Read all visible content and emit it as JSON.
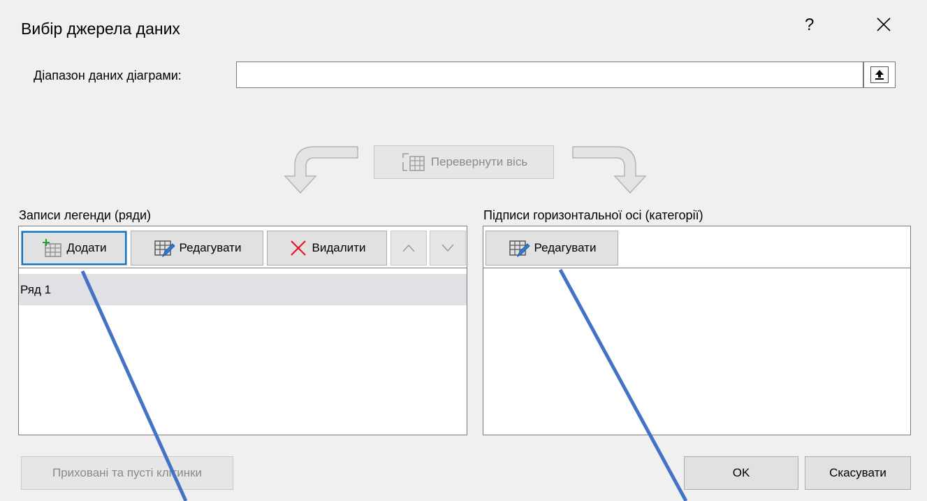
{
  "dialog": {
    "title": "Вибір джерела даних",
    "help": "?",
    "close_icon": "close-icon"
  },
  "range": {
    "label": "Діапазон даних діаграми:",
    "value": ""
  },
  "switch": {
    "label": "Перевернути вісь"
  },
  "legend": {
    "header": "Записи легенди (ряди)",
    "add_label": "Додати",
    "edit_label": "Редагувати",
    "delete_label": "Видалити",
    "series": [
      "Ряд 1"
    ]
  },
  "axis": {
    "header": "Підписи горизонтальної осі (категорії)",
    "edit_label": "Редагувати"
  },
  "footer": {
    "hidden_cells_label": "Приховані та пусті клітинки",
    "ok_label": "OK",
    "cancel_label": "Скасувати"
  },
  "colors": {
    "accent": "#0078d7",
    "annotation_line": "#4472c4",
    "delete_x": "#e81123"
  }
}
